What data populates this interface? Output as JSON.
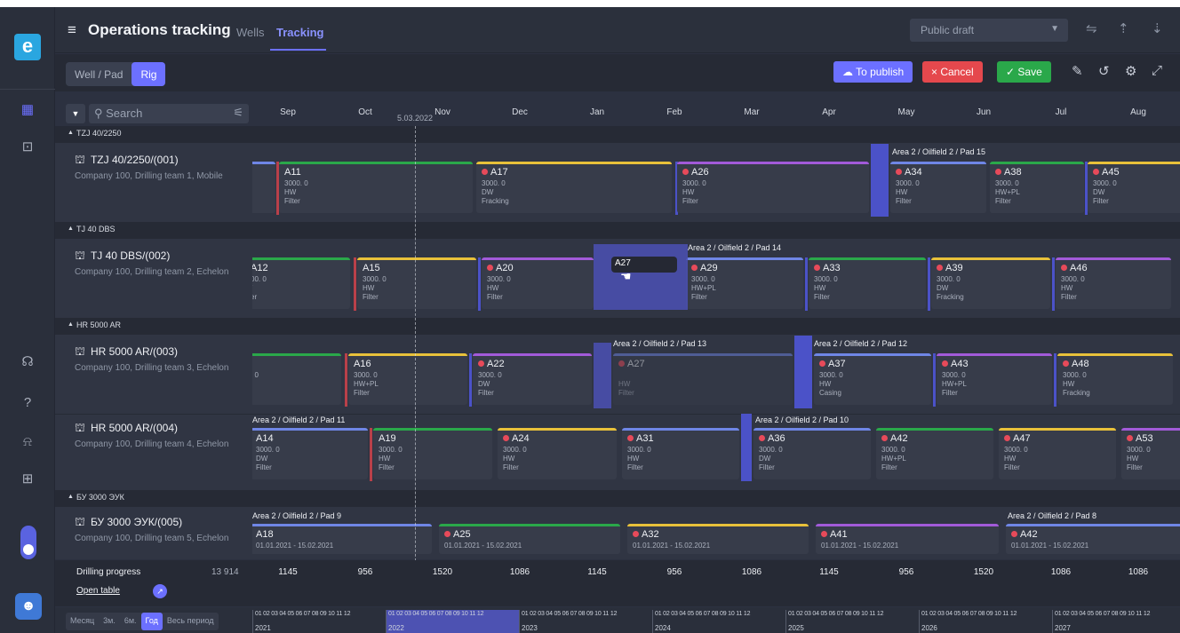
{
  "header": {
    "title": "Operations tracking",
    "tabs": [
      {
        "label": "Wells"
      },
      {
        "label": "Tracking"
      }
    ],
    "draft": "Public draft"
  },
  "toolbar": {
    "mode": [
      "Well / Pad",
      "Rig"
    ],
    "publish": "To publish",
    "cancel": "Cancel",
    "save": "Save"
  },
  "search": {
    "placeholder": "Search"
  },
  "today": "5.03.2022",
  "months": [
    "Sep",
    "Oct",
    "Nov",
    "Dec",
    "Jan",
    "Feb",
    "Mar",
    "Apr",
    "May",
    "Jun",
    "Jul",
    "Aug"
  ],
  "groups": [
    {
      "name": "TZJ 40/2250"
    },
    {
      "name": "TJ 40 DBS"
    },
    {
      "name": "HR 5000 AR"
    },
    {
      "name": "БУ 3000 ЭУК"
    }
  ],
  "rigs": [
    {
      "name": "TZJ 40/2250/(001)",
      "sub": "Company 100, Drilling team 1, Mobile"
    },
    {
      "name": "TJ 40 DBS/(002)",
      "sub": "Company 100, Drilling team 2, Echelon"
    },
    {
      "name": "HR 5000 AR/(003)",
      "sub": "Company 100, Drilling team 3, Echelon"
    },
    {
      "name": "HR 5000 AR/(004)",
      "sub": "Company 100, Drilling team 4, Echelon"
    },
    {
      "name": "БУ 3000 ЭУК/(005)",
      "sub": "Company 100, Drilling team 5, Echelon"
    }
  ],
  "pads": [
    "Area 2 / Oilfield 2 / Pad 15",
    "Area 2 / Oilfield 2 / Pad 14",
    "Area 2 / Oilfield 2 / Pad 13",
    "Area 2 / Oilfield 2 / Pad 12",
    "Area 2 / Oilfield 2 / Pad 11",
    "Area 2 / Oilfield 2 / Pad 10",
    "Area 2 / Oilfield 2 / Pad 9",
    "Area 2 / Oilfield 2 / Pad 8"
  ],
  "wells": {
    "r1": [
      {
        "n": "A11",
        "a": "3000. 0",
        "b": "HW",
        "c": "Filter"
      },
      {
        "n": "A17",
        "a": "3000. 0",
        "b": "DW",
        "c": "Fracking"
      },
      {
        "n": "A26",
        "a": "3000. 0",
        "b": "HW",
        "c": "Filter"
      },
      {
        "n": "A34",
        "a": "3000. 0",
        "b": "HW",
        "c": "Filter"
      },
      {
        "n": "A38",
        "a": "3000. 0",
        "b": "HW+PL",
        "c": "Filter"
      },
      {
        "n": "A45",
        "a": "3000. 0",
        "b": "DW",
        "c": "Filter"
      }
    ],
    "r2": [
      {
        "n": "A12",
        "a": "00. 0",
        "b": "/",
        "c": "er"
      },
      {
        "n": "A15",
        "a": "3000. 0",
        "b": "HW",
        "c": "Filter"
      },
      {
        "n": "A20",
        "a": "3000. 0",
        "b": "HW",
        "c": "Filter"
      },
      {
        "n": "A29",
        "a": "3000. 0",
        "b": "HW+PL",
        "c": "Filter"
      },
      {
        "n": "A33",
        "a": "3000. 0",
        "b": "HW",
        "c": "Filter"
      },
      {
        "n": "A39",
        "a": "3000. 0",
        "b": "DW",
        "c": "Fracking"
      },
      {
        "n": "A46",
        "a": "3000. 0",
        "b": "HW",
        "c": "Filter"
      }
    ],
    "r3": [
      {
        "n": "",
        "a": ". 0",
        "b": "",
        "c": ""
      },
      {
        "n": "A16",
        "a": "3000. 0",
        "b": "HW+PL",
        "c": "Filter"
      },
      {
        "n": "A22",
        "a": "3000. 0",
        "b": "DW",
        "c": "Filter"
      },
      {
        "n": "A27",
        "a": "",
        "b": "HW",
        "c": "Filter"
      },
      {
        "n": "A37",
        "a": "3000. 0",
        "b": "HW",
        "c": "Casing"
      },
      {
        "n": "A43",
        "a": "3000. 0",
        "b": "HW+PL",
        "c": "Filter"
      },
      {
        "n": "A48",
        "a": "3000. 0",
        "b": "HW",
        "c": "Fracking"
      }
    ],
    "r4": [
      {
        "n": "A14",
        "a": "3000. 0",
        "b": "DW",
        "c": "Filter"
      },
      {
        "n": "A19",
        "a": "3000. 0",
        "b": "HW",
        "c": "Filter"
      },
      {
        "n": "A24",
        "a": "3000. 0",
        "b": "HW",
        "c": "Filter"
      },
      {
        "n": "A31",
        "a": "3000. 0",
        "b": "HW",
        "c": "Filter"
      },
      {
        "n": "A36",
        "a": "3000. 0",
        "b": "DW",
        "c": "Filter"
      },
      {
        "n": "A42",
        "a": "3000. 0",
        "b": "HW+PL",
        "c": "Filter"
      },
      {
        "n": "A47",
        "a": "3000. 0",
        "b": "HW",
        "c": "Filter"
      },
      {
        "n": "A53",
        "a": "3000. 0",
        "b": "HW",
        "c": "Filter"
      }
    ],
    "r5": [
      {
        "n": "A18",
        "a": "01.01.2021 - 15.02.2021"
      },
      {
        "n": "A25",
        "a": "01.01.2021 - 15.02.2021"
      },
      {
        "n": "A32",
        "a": "01.01.2021 - 15.02.2021"
      },
      {
        "n": "A41",
        "a": "01.01.2021 - 15.02.2021"
      },
      {
        "n": "A42",
        "a": "01.01.2021 - 15.02.2021"
      }
    ]
  },
  "drag": {
    "label": "A27"
  },
  "progress": {
    "label": "Drilling progress",
    "total": "13 914",
    "link": "Open table",
    "values": [
      "1145",
      "956",
      "1520",
      "1086",
      "1145",
      "956",
      "1086",
      "1145",
      "956",
      "1520",
      "1086",
      "1086"
    ]
  },
  "periods": [
    "Месяц",
    "3м.",
    "6м.",
    "Год",
    "Весь период"
  ],
  "years": [
    "2021",
    "2022",
    "2023",
    "2024",
    "2025",
    "2026",
    "2027"
  ],
  "monthnums": "01 02 03 04 05 06 07 08 09 10 11 12",
  "colors": {
    "accent": "#6c70ff",
    "green": "#2aa84a",
    "red": "#e74a5a",
    "yellow": "#e8c13a",
    "purple": "#a25ad9",
    "blue": "#6f86e6"
  }
}
